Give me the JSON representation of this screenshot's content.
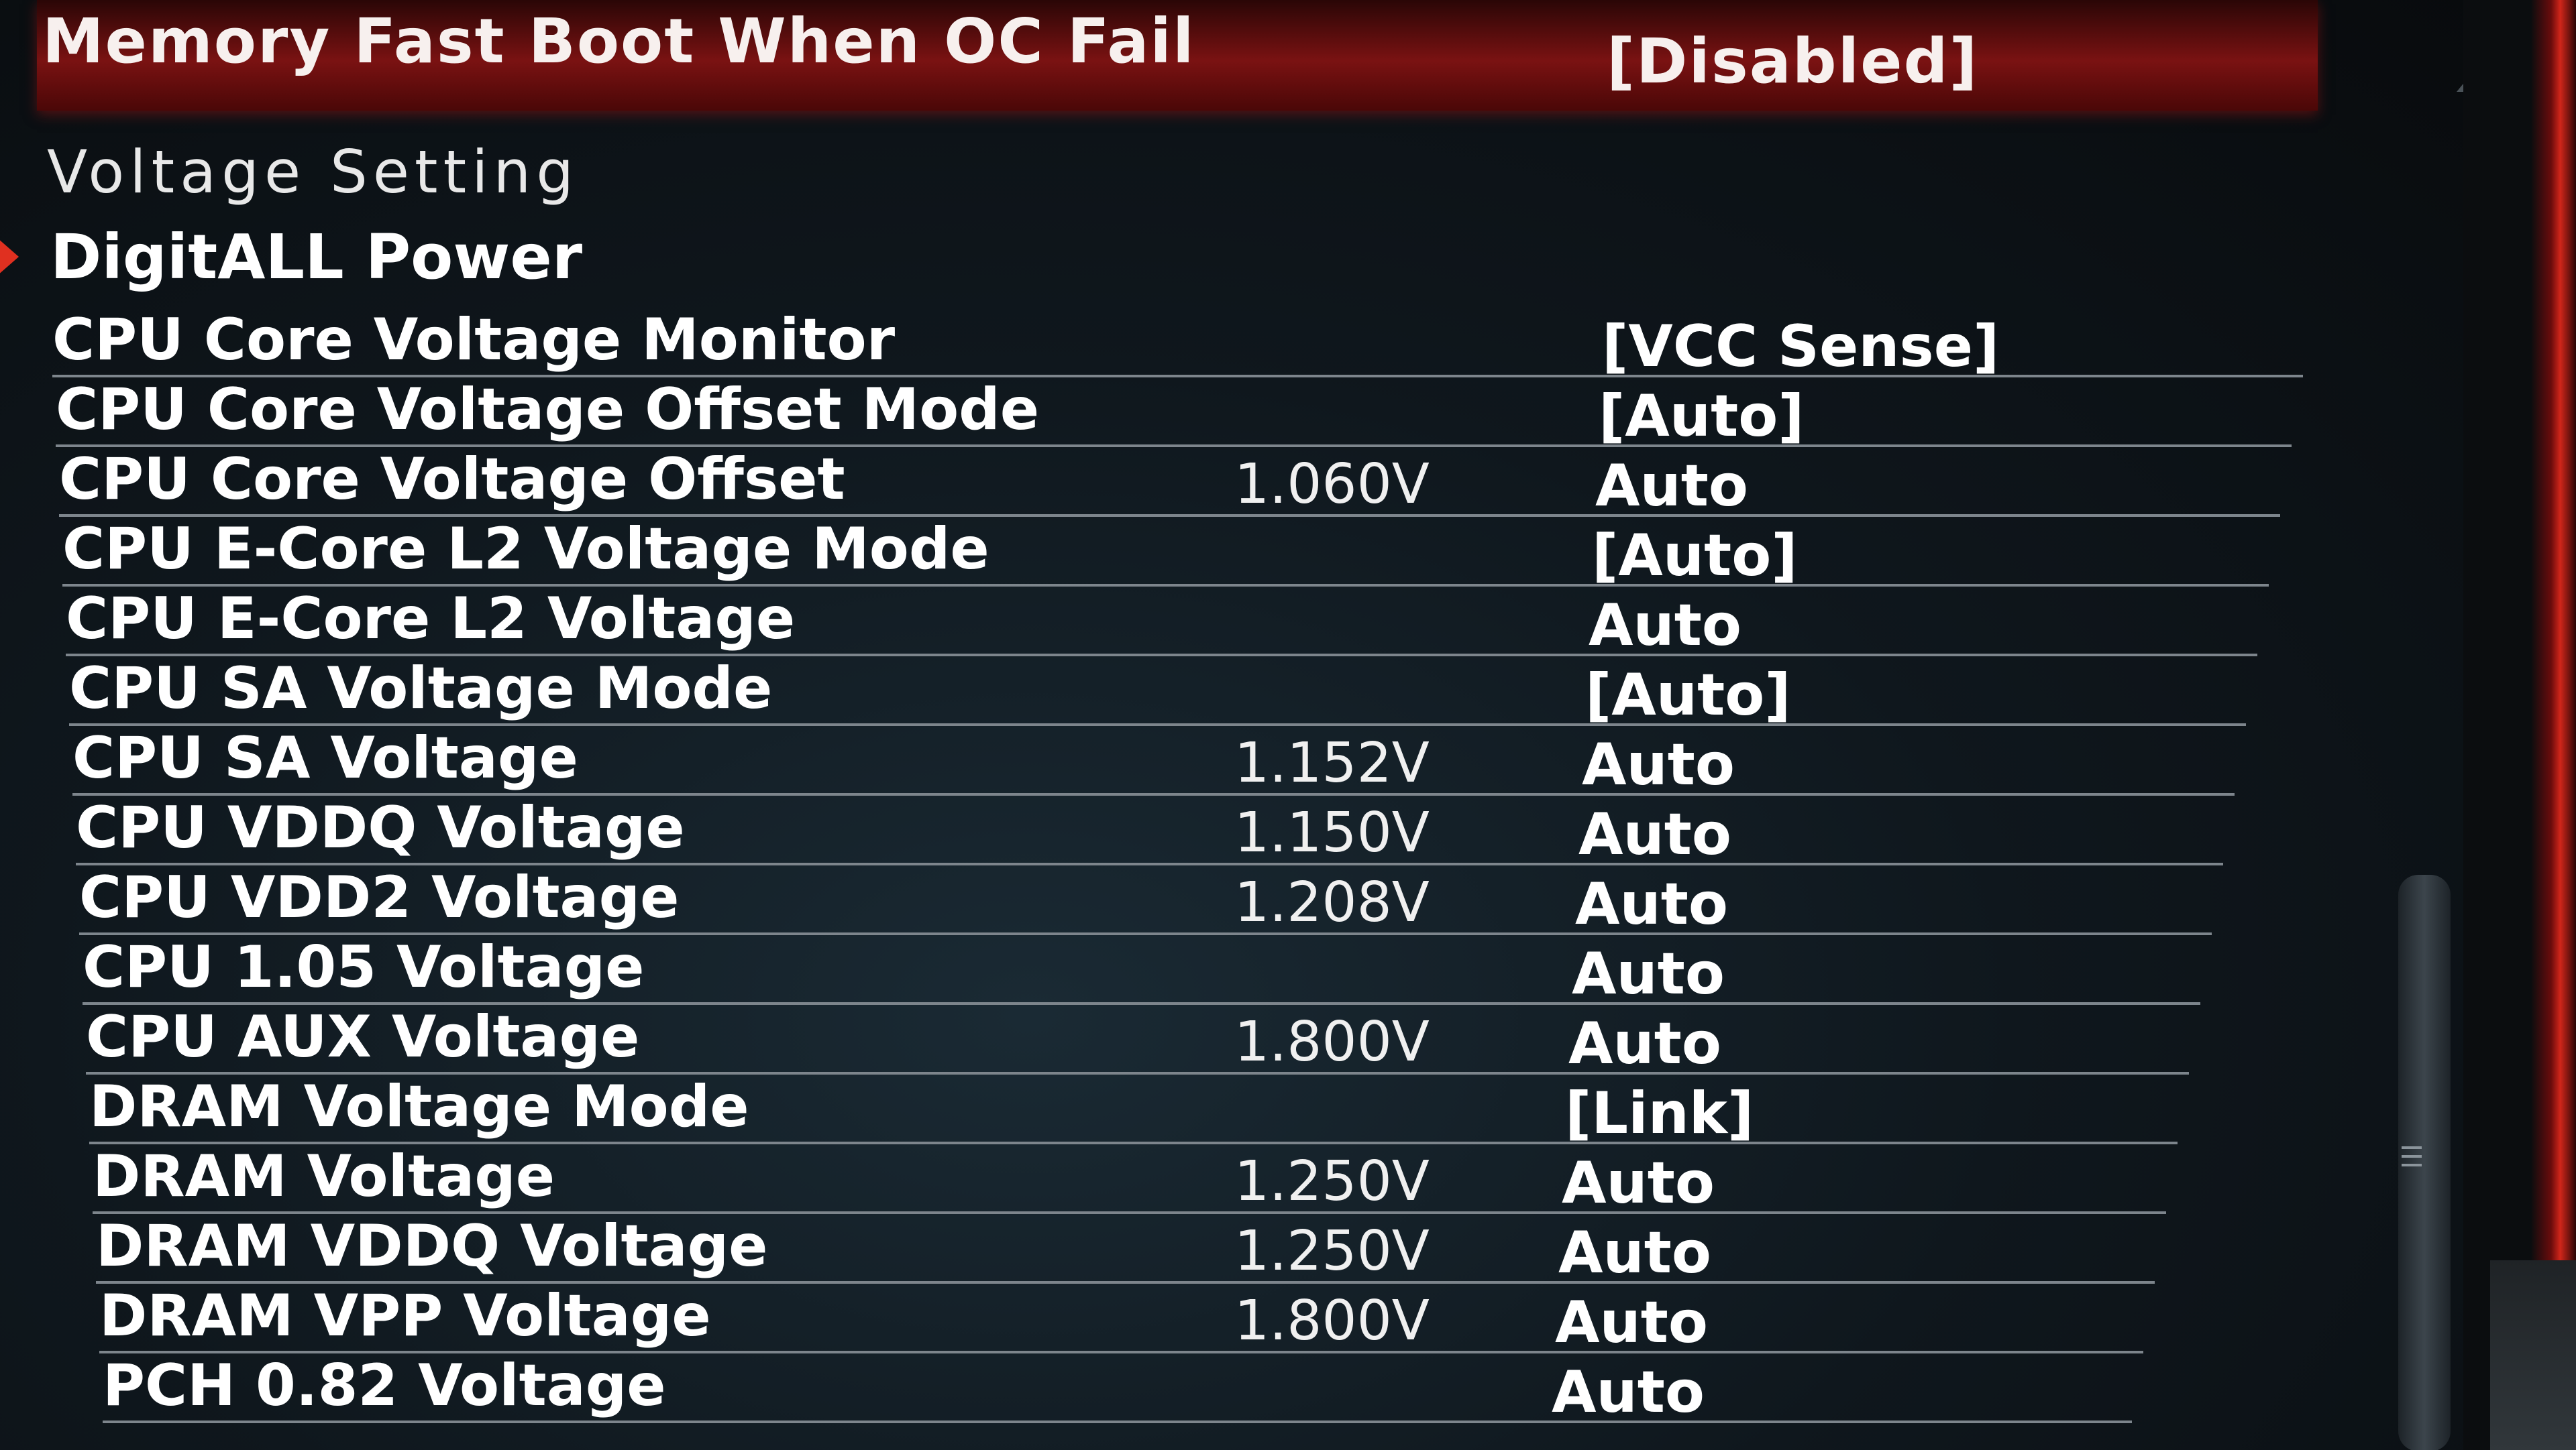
{
  "highlighted": {
    "label": "Memory Fast Boot When OC Fail",
    "value": "[Disabled]"
  },
  "section": {
    "title": "Voltage  Setting"
  },
  "submenu": {
    "label": "DigitALL Power"
  },
  "settings": [
    {
      "name": "CPU Core Voltage Monitor",
      "reading": "",
      "value": "[VCC Sense]"
    },
    {
      "name": "CPU Core Voltage Offset Mode",
      "reading": "",
      "value": "[Auto]"
    },
    {
      "name": "CPU Core Voltage Offset",
      "reading": "1.060V",
      "value": "Auto"
    },
    {
      "name": "CPU E-Core L2 Voltage Mode",
      "reading": "",
      "value": "[Auto]"
    },
    {
      "name": "CPU E-Core L2 Voltage",
      "reading": "",
      "value": "Auto"
    },
    {
      "name": "CPU SA Voltage Mode",
      "reading": "",
      "value": "[Auto]"
    },
    {
      "name": "CPU SA Voltage",
      "reading": "1.152V",
      "value": "Auto"
    },
    {
      "name": "CPU VDDQ Voltage",
      "reading": "1.150V",
      "value": "Auto"
    },
    {
      "name": "CPU VDD2 Voltage",
      "reading": "1.208V",
      "value": "Auto"
    },
    {
      "name": "CPU 1.05 Voltage",
      "reading": "",
      "value": "Auto"
    },
    {
      "name": "CPU AUX Voltage",
      "reading": "1.800V",
      "value": "Auto"
    },
    {
      "name": "DRAM Voltage Mode",
      "reading": "",
      "value": "[Link]"
    },
    {
      "name": "DRAM Voltage",
      "reading": "1.250V",
      "value": "Auto"
    },
    {
      "name": "DRAM VDDQ Voltage",
      "reading": "1.250V",
      "value": "Auto"
    },
    {
      "name": "DRAM VPP Voltage",
      "reading": "1.800V",
      "value": "Auto"
    },
    {
      "name": "PCH 0.82 Voltage",
      "reading": "",
      "value": "Auto"
    }
  ],
  "colors": {
    "highlight": "#7a1212",
    "accent_red": "#d1261a",
    "text": "#ffffff",
    "divider": "#7d858c"
  },
  "icons": {
    "submenu_marker": "submenu-arrow-icon",
    "scroll_up": "scroll-up-arrow-icon",
    "scroll_grip": "grip-lines-icon"
  }
}
